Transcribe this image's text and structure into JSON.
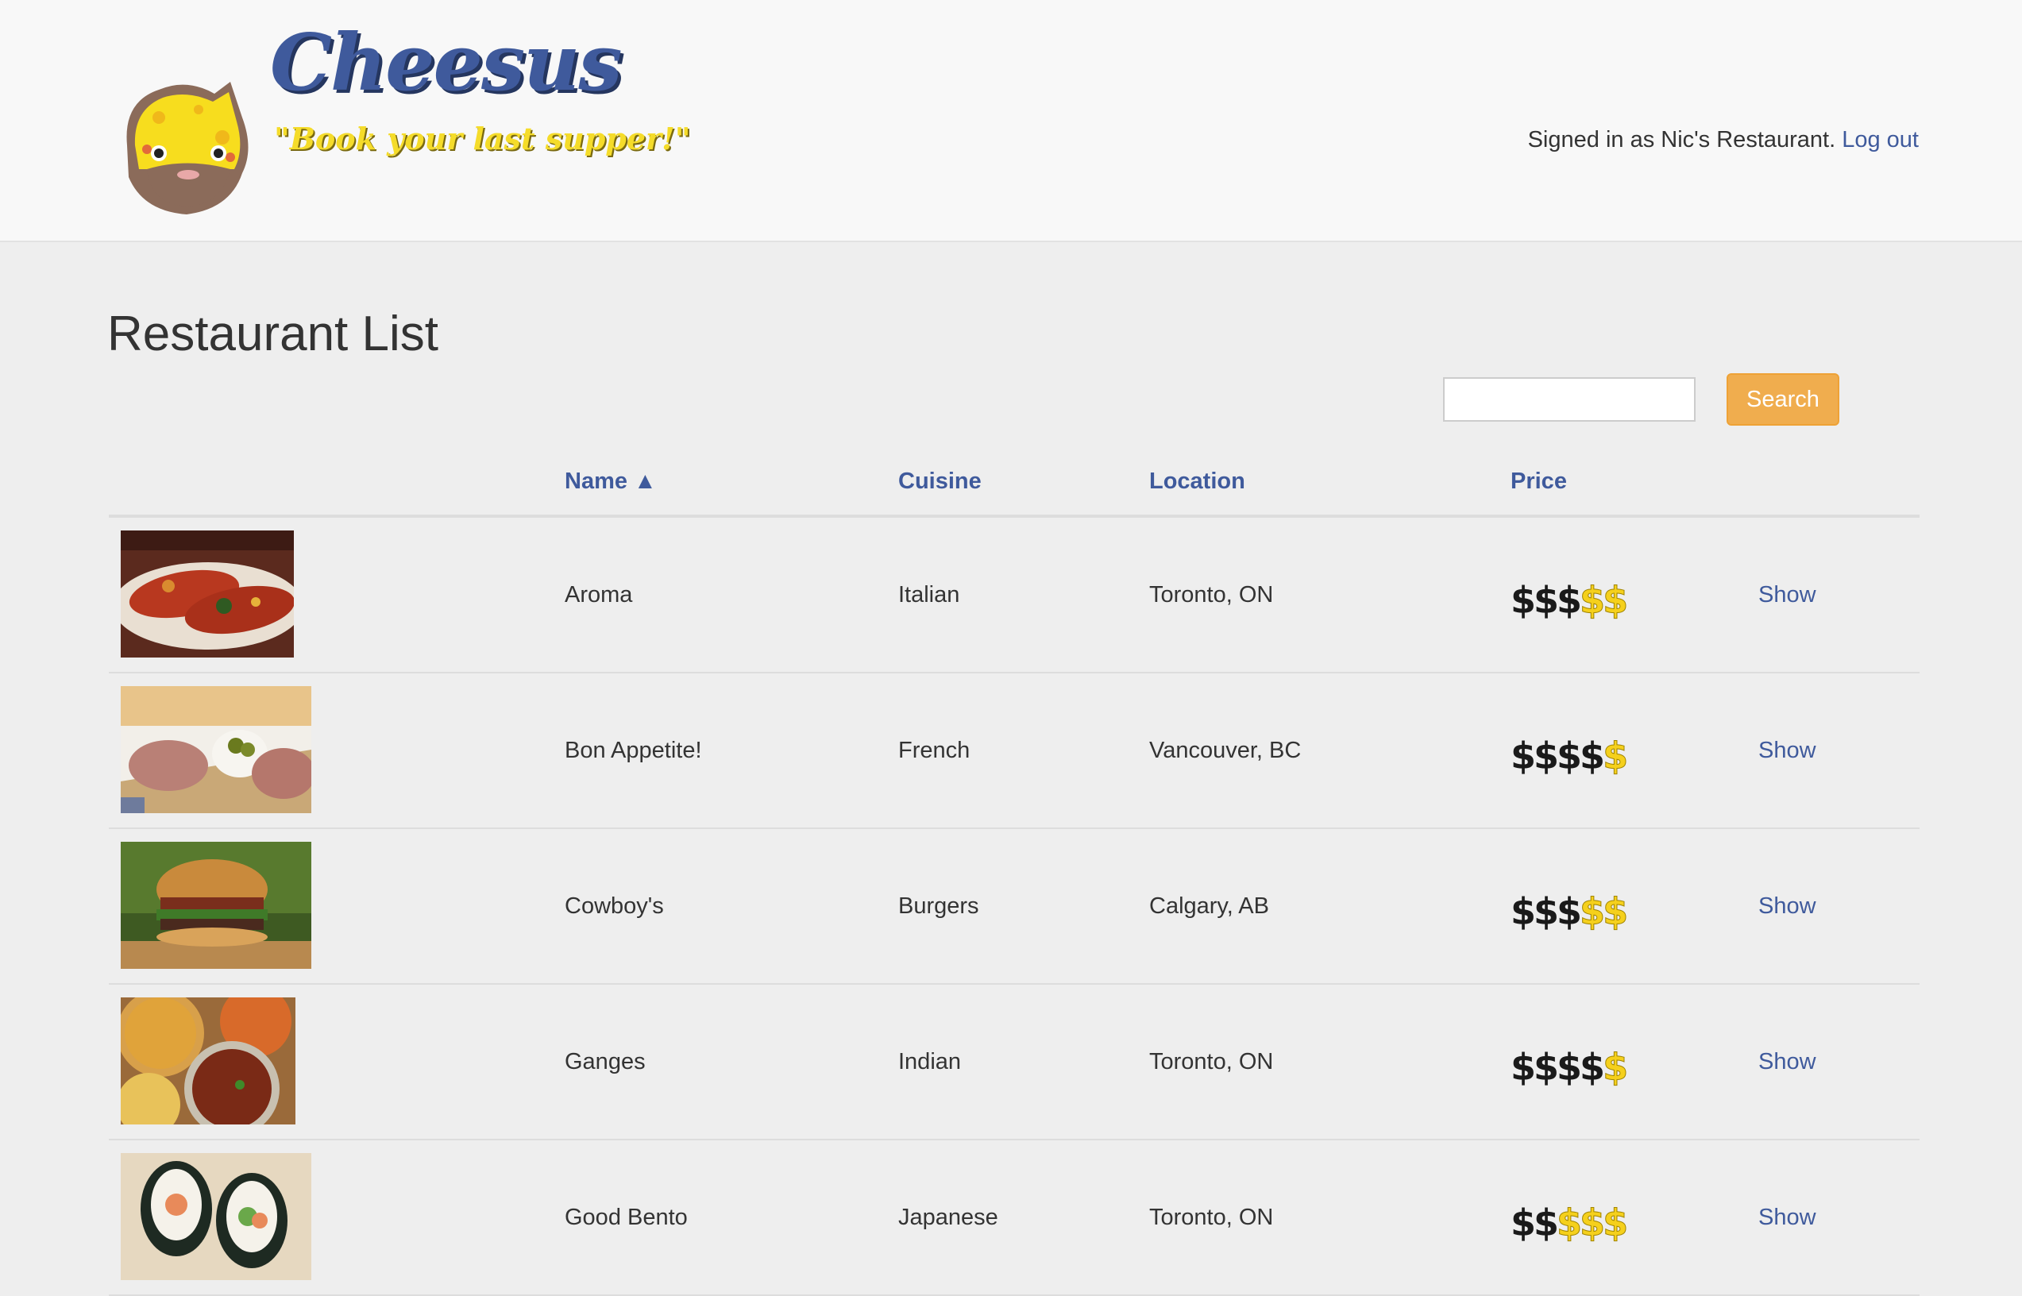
{
  "header": {
    "brand_title": "Cheesus",
    "tagline": "\"Book your last supper!\"",
    "signed_in_text": "Signed in as Nic's Restaurant.",
    "logout_label": "Log out"
  },
  "page_title": "Restaurant List",
  "search": {
    "value": "",
    "placeholder": "",
    "button_label": "Search"
  },
  "table": {
    "headers": {
      "name": "Name ▲",
      "cuisine": "Cuisine",
      "location": "Location",
      "price": "Price"
    },
    "rows": [
      {
        "name": "Aroma",
        "cuisine": "Italian",
        "location": "Toronto, ON",
        "price_level": 3,
        "price_max": 5,
        "action": "Show",
        "image": "enchiladas-photo"
      },
      {
        "name": "Bon Appetite!",
        "cuisine": "French",
        "location": "Vancouver, BC",
        "price_level": 4,
        "price_max": 5,
        "action": "Show",
        "image": "pate-photo"
      },
      {
        "name": "Cowboy's",
        "cuisine": "Burgers",
        "location": "Calgary, AB",
        "price_level": 3,
        "price_max": 5,
        "action": "Show",
        "image": "burger-photo"
      },
      {
        "name": "Ganges",
        "cuisine": "Indian",
        "location": "Toronto, ON",
        "price_level": 4,
        "price_max": 5,
        "action": "Show",
        "image": "curry-photo"
      },
      {
        "name": "Good Bento",
        "cuisine": "Japanese",
        "location": "Toronto, ON",
        "price_level": 2,
        "price_max": 5,
        "action": "Show",
        "image": "sushi-photo"
      }
    ]
  },
  "colors": {
    "link": "#3f5a9c",
    "search_button": "#f0ad4e",
    "price_active": "#1a1a1a",
    "price_inactive": "#f5d01c"
  }
}
